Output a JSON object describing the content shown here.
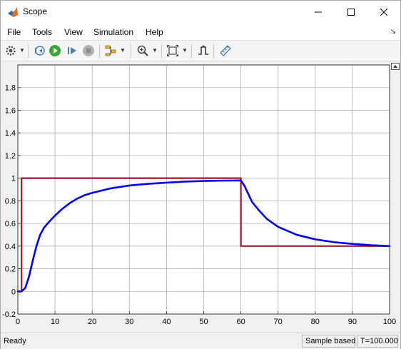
{
  "window": {
    "title": "Scope"
  },
  "menu": {
    "items": [
      "File",
      "Tools",
      "View",
      "Simulation",
      "Help"
    ]
  },
  "toolbar": {
    "icons": [
      "gear-icon",
      "step-back-icon",
      "run-icon",
      "step-forward-icon",
      "stop-icon",
      "signal-select-icon",
      "zoom-icon",
      "autoscale-icon",
      "triggers-icon",
      "measure-icon"
    ]
  },
  "status": {
    "left": "Ready",
    "mode": "Sample based",
    "time": "T=100.000"
  },
  "colors": {
    "reference": "#A2142F",
    "response": "#0000FF",
    "grid": "#b0b0b0"
  },
  "chart_data": {
    "type": "line",
    "title": "",
    "xlabel": "",
    "ylabel": "",
    "xlim": [
      0,
      100
    ],
    "ylim": [
      -0.2,
      2.0
    ],
    "xticks": [
      "0",
      "10",
      "20",
      "30",
      "40",
      "50",
      "60",
      "70",
      "80",
      "90",
      "100"
    ],
    "yticks": [
      "-0.2",
      "0",
      "0.2",
      "0.4",
      "0.6",
      "0.8",
      "1",
      "1.2",
      "1.4",
      "1.6",
      "1.8"
    ],
    "grid": true,
    "series": [
      {
        "color": "#A2142F",
        "x": [
          0,
          1,
          1,
          60,
          60,
          100
        ],
        "y": [
          0,
          0,
          1,
          1,
          0.4,
          0.4
        ]
      },
      {
        "color": "#0000FF",
        "x": [
          0,
          1,
          2,
          3,
          4,
          5,
          6,
          7,
          8,
          10,
          12,
          14,
          16,
          18,
          20,
          25,
          30,
          35,
          40,
          45,
          50,
          55,
          60,
          61,
          62,
          63,
          65,
          67,
          70,
          75,
          80,
          85,
          90,
          95,
          100
        ],
        "y": [
          0,
          0,
          0.03,
          0.13,
          0.27,
          0.4,
          0.5,
          0.56,
          0.6,
          0.67,
          0.73,
          0.78,
          0.82,
          0.85,
          0.87,
          0.91,
          0.935,
          0.95,
          0.96,
          0.97,
          0.975,
          0.978,
          0.98,
          0.93,
          0.86,
          0.79,
          0.71,
          0.64,
          0.57,
          0.5,
          0.46,
          0.435,
          0.42,
          0.408,
          0.4
        ]
      }
    ]
  }
}
